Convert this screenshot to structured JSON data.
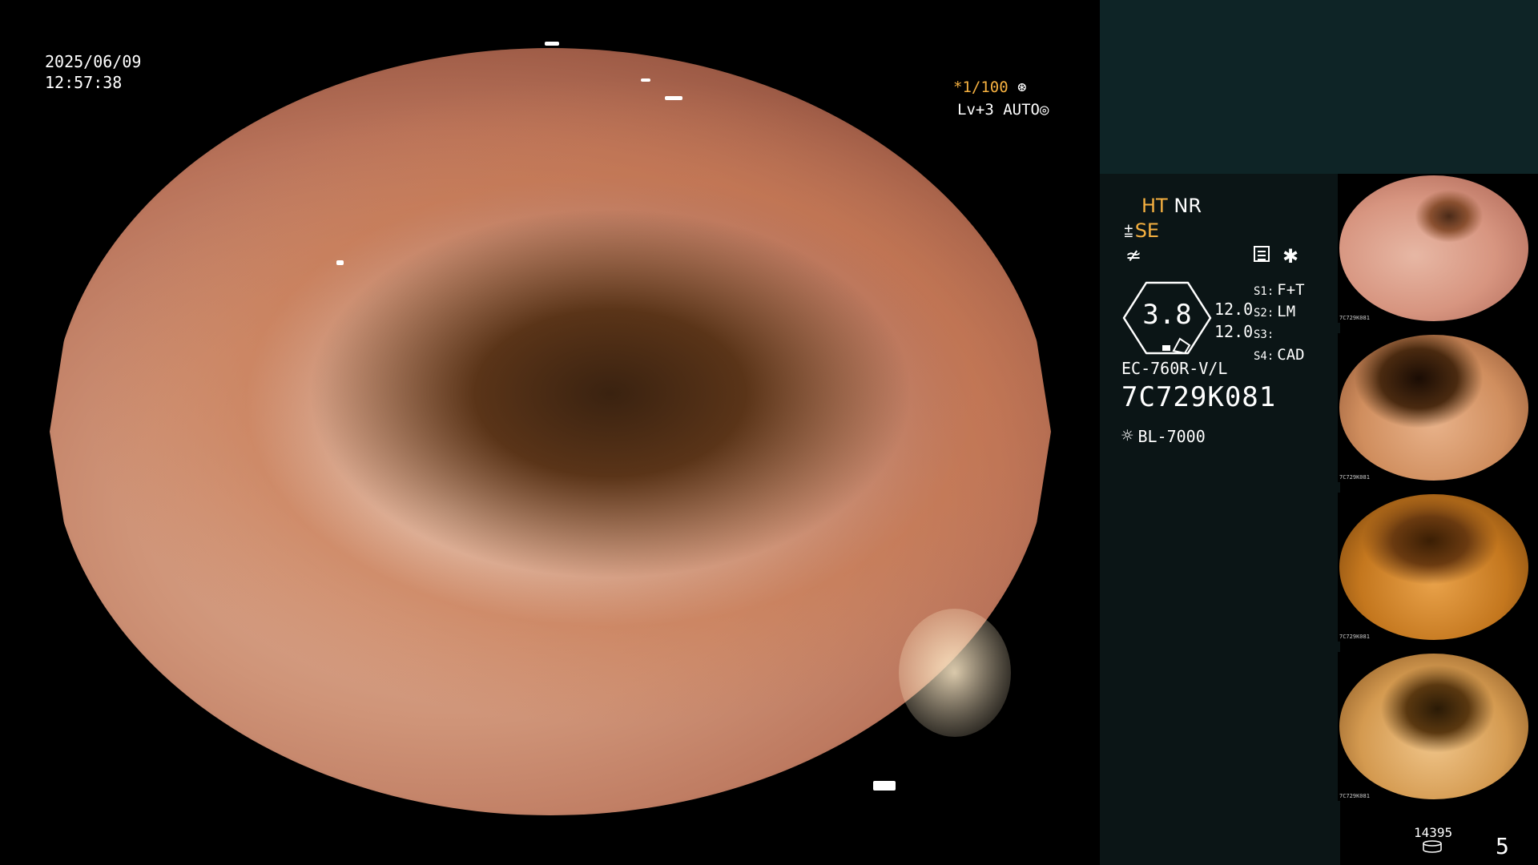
{
  "overlay": {
    "date": "2025/06/09",
    "time": "12:57:38",
    "shutter_prefix": "*",
    "shutter": "1/100",
    "level": "Lv+3",
    "mode": "AUTO"
  },
  "panel": {
    "ht": "HT",
    "nr": "NR",
    "se": "SE",
    "gauge_value": "3.8",
    "num1": "12.0",
    "num2": "12.0",
    "slots": [
      {
        "label": "S1:",
        "value": "F+T"
      },
      {
        "label": "S2:",
        "value": "LM"
      },
      {
        "label": "S3:",
        "value": ""
      },
      {
        "label": "S4:",
        "value": "CAD"
      }
    ],
    "scope_model": "EC-760R-V/L",
    "serial": "7C729K081",
    "light_source": "BL-7000"
  },
  "thumbnails": [
    {
      "caption": "7C729K081"
    },
    {
      "caption": "7C729K081"
    },
    {
      "caption": "7C729K081"
    },
    {
      "caption": "7C729K081"
    }
  ],
  "footer": {
    "counter": "14395",
    "page": "5"
  },
  "colors": {
    "accent": "#f5b040",
    "panel_top": "#0e2426",
    "panel_body": "#0b1516"
  }
}
